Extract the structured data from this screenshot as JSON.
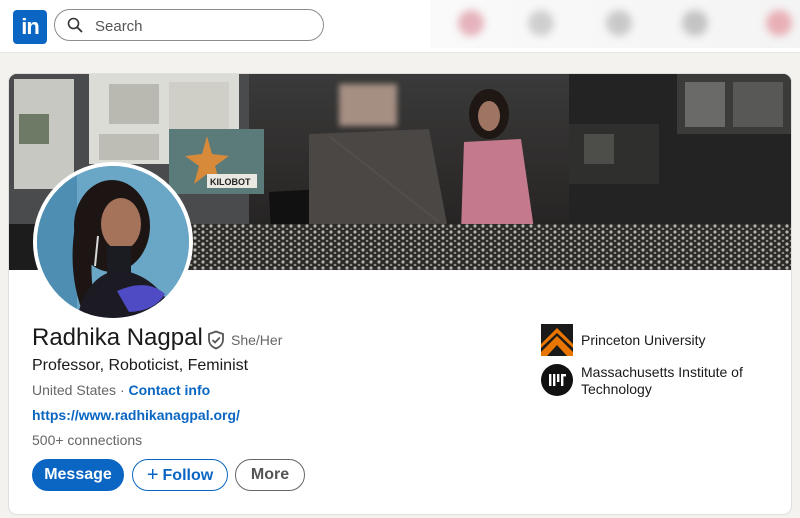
{
  "nav": {
    "logo_text": "in",
    "search_placeholder": "Search"
  },
  "profile": {
    "name": "Radhika Nagpal",
    "pronouns": "She/Her",
    "headline": "Professor, Roboticist, Feminist",
    "location": "United States",
    "separator": "·",
    "contact_label": "Contact info",
    "website": "https://www.radhikanagpal.org/",
    "connections": "500+ connections"
  },
  "actions": {
    "message_label": "Message",
    "follow_label": "Follow",
    "more_label": "More"
  },
  "education": [
    {
      "name": "Princeton University",
      "logo": "princeton-shield-icon"
    },
    {
      "name": "Massachusetts Institute of Technology",
      "logo": "mit-logo-icon"
    }
  ],
  "banner": {
    "kilobot_label": "KILOBOT"
  },
  "colors": {
    "brand": "#0a66c2",
    "princeton_orange": "#e77500"
  }
}
